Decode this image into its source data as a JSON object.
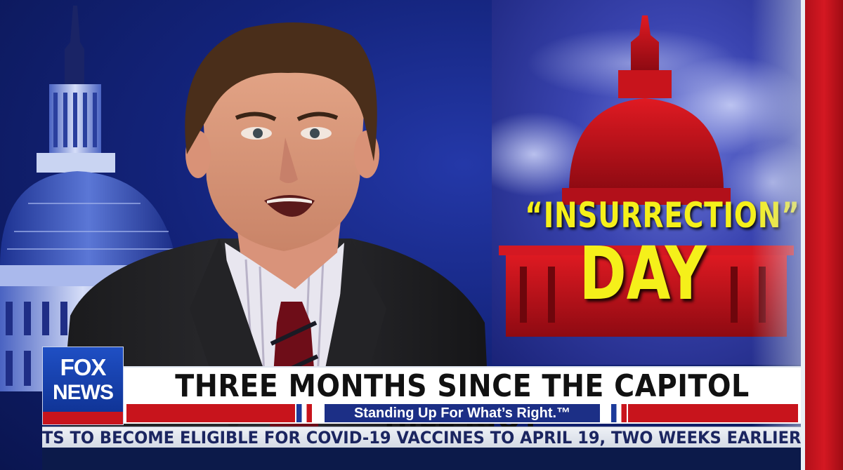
{
  "graphic": {
    "quote_line": "“INSURRECTION”",
    "day_line": "DAY",
    "accent_color": "#f5f01a",
    "capitol_color": "#c8141c"
  },
  "network_logo": {
    "line1": "FOX",
    "line2": "NEWS"
  },
  "lower_third": {
    "headline": "THREE MONTHS SINCE THE CAPITOL HILL RIOT",
    "tagline": "Standing Up For What’s Right.™"
  },
  "ticker": {
    "text": "TS TO BECOME ELIGIBLE FOR COVID-19 VACCINES TO APRIL 19, TWO WEEKS EARLIER THAN PREVIOUS MAY"
  },
  "colors": {
    "brand_blue": "#1c2f86",
    "brand_red": "#c8141c"
  }
}
